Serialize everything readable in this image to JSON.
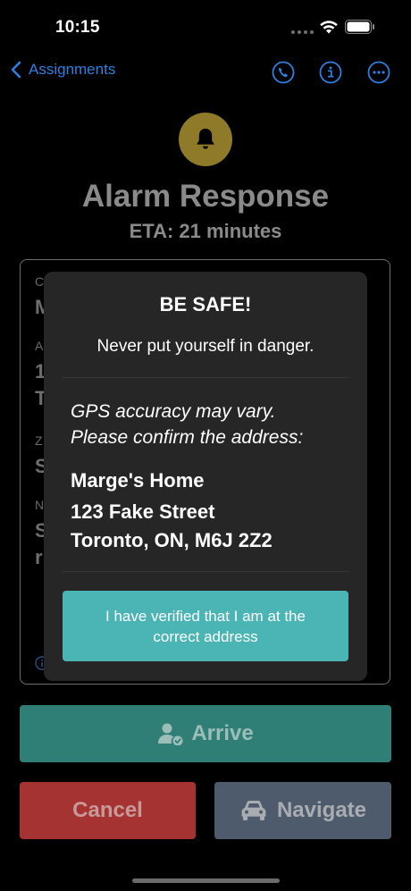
{
  "status_bar": {
    "time": "10:15"
  },
  "nav": {
    "back_label": "Assignments",
    "accent_color": "#2f7fe0"
  },
  "header": {
    "icon": "bell-icon",
    "title": "Alarm Response",
    "eta": "ETA: 21 minutes"
  },
  "modal": {
    "title": "BE SAFE!",
    "warning": "Never put yourself in danger.",
    "gps_note_line1": "GPS accuracy may vary.",
    "gps_note_line2": "Please confirm the address:",
    "address_name": "Marge's Home",
    "address_street": "123 Fake Street",
    "address_city": "Toronto, ON, M6J 2Z2",
    "confirm_button": "I have verified that I am at the correct address"
  },
  "actions": {
    "arrive": "Arrive",
    "cancel": "Cancel",
    "navigate": "Navigate"
  },
  "colors": {
    "arrive": "#2f7f76",
    "cancel": "#a53331",
    "navigate": "#4e5b6d",
    "confirm": "#4bb5b5",
    "bell": "#8e7a29"
  }
}
